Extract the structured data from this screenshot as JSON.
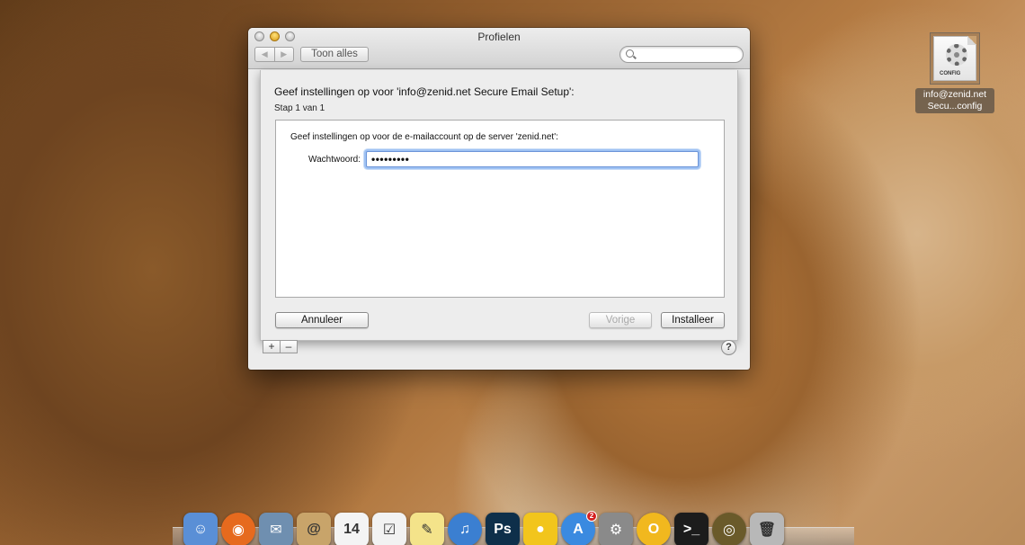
{
  "window": {
    "title": "Profielen",
    "nav_back": "◀",
    "nav_forward": "▶",
    "show_all": "Toon alles",
    "search_value": ""
  },
  "sheet": {
    "heading": "Geef instellingen op voor 'info@zenid.net Secure Email Setup':",
    "step": "Stap 1 van 1",
    "panel_text": "Geef instellingen op voor de e-mailaccount op de server 'zenid.net':",
    "password_label": "Wachtwoord:",
    "password_value": "•••••••••",
    "cancel": "Annuleer",
    "previous": "Vorige",
    "install": "Installeer"
  },
  "footer": {
    "add": "+",
    "remove": "–",
    "help": "?"
  },
  "desktop_icon": {
    "badge": "CONFIG",
    "caption": "info@zenid.net Secu...config"
  },
  "dock": [
    {
      "name": "finder",
      "glyph": "☺",
      "color": "#5a8fd6"
    },
    {
      "name": "firefox",
      "glyph": "◉",
      "color": "#e66a1e"
    },
    {
      "name": "mail",
      "glyph": "✉",
      "color": "#6f8fb0"
    },
    {
      "name": "contacts",
      "glyph": "@",
      "color": "#c8a46a"
    },
    {
      "name": "calendar",
      "glyph": "14",
      "color": "#f4f4f4"
    },
    {
      "name": "reminders",
      "glyph": "☑",
      "color": "#f2f2f2"
    },
    {
      "name": "notes",
      "glyph": "✎",
      "color": "#f4e38a"
    },
    {
      "name": "itunes",
      "glyph": "♫",
      "color": "#3b7fd1"
    },
    {
      "name": "photoshop",
      "glyph": "Ps",
      "color": "#0e2f4a"
    },
    {
      "name": "cyberduck",
      "glyph": "●",
      "color": "#f2c51c"
    },
    {
      "name": "app-store",
      "glyph": "A",
      "color": "#3a8ae0",
      "badge": "2"
    },
    {
      "name": "system-preferences",
      "glyph": "⚙",
      "color": "#8a8a8a"
    },
    {
      "name": "opera",
      "glyph": "O",
      "color": "#f1b81e"
    },
    {
      "name": "terminal",
      "glyph": ">_",
      "color": "#1c1c1c"
    },
    {
      "name": "disk-utility",
      "glyph": "◎",
      "color": "#6a5a2a"
    },
    {
      "name": "trash",
      "glyph": "🗑",
      "color": "#b8b8b8"
    }
  ]
}
